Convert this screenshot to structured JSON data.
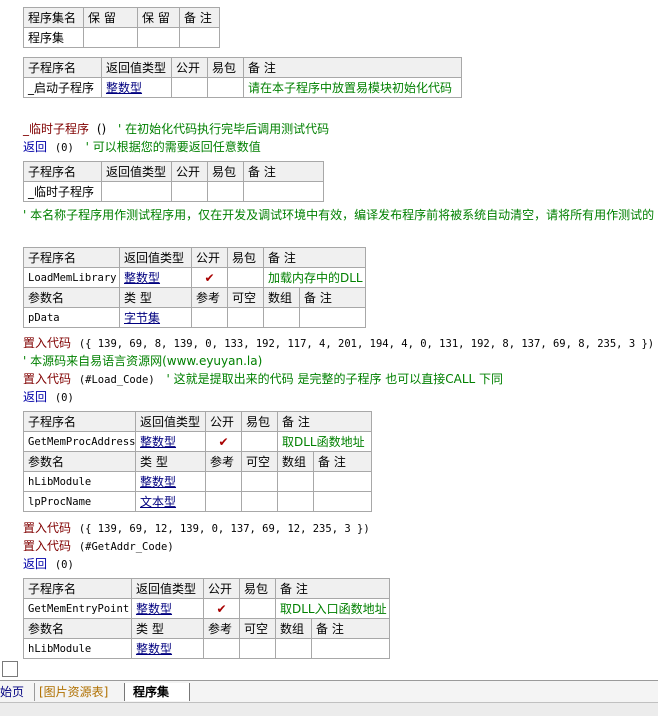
{
  "assembly_table": {
    "headers": [
      "程序集名",
      "保 留",
      "保 留",
      "备 注"
    ],
    "row": [
      "程序集",
      "",
      "",
      ""
    ]
  },
  "sub_start": {
    "headers": [
      "子程序名",
      "返回值类型",
      "公开",
      "易包",
      "备 注"
    ],
    "row": [
      "_启动子程序",
      "整数型",
      "",
      "",
      "请在本子程序中放置易模块初始化代码"
    ]
  },
  "temp_code": {
    "line1_name": "_临时子程序",
    "line1_paren": "()",
    "line1_comment": "' 在初始化代码执行完毕后调用测试代码",
    "line2_kw": "返回",
    "line2_arg": "(0)",
    "line2_comment": "' 可以根据您的需要返回任意数值"
  },
  "sub_temp": {
    "headers": [
      "子程序名",
      "返回值类型",
      "公开",
      "易包",
      "备 注"
    ],
    "row": [
      "_临时子程序",
      "",
      "",
      "",
      ""
    ]
  },
  "temp_note": "' 本名称子程序用作测试程序用，仅在开发及调试环境中有效，编译发布程序前将被系统自动清空，请将所有用作测试的",
  "sub_load": {
    "headers": [
      "子程序名",
      "返回值类型",
      "公开",
      "易包",
      "备 注"
    ],
    "row": [
      "LoadMemLibrary",
      "整数型",
      "✔",
      "",
      "加载内存中的DLL"
    ],
    "param_headers": [
      "参数名",
      "类 型",
      "参考",
      "可空",
      "数组",
      "备 注"
    ],
    "params": [
      [
        "pData",
        "字节集",
        "",
        "",
        "",
        ""
      ]
    ]
  },
  "load_code": {
    "l1_kw": "置入代码",
    "l1_arg": "({ 139, 69, 8, 139, 0, 133, 192, 117, 4, 201, 194, 4, 0, 131, 192, 8, 137, 69, 8, 235, 3 })",
    "l2": "' 本源码来自易语言资源网(www.eyuyan.la)",
    "l3_kw": "置入代码",
    "l3_arg": "(#Load_Code)",
    "l3_comment": "' 这就是提取出来的代码 是完整的子程序 也可以直接CALL 下同",
    "l4_kw": "返回",
    "l4_arg": "(0)"
  },
  "sub_proc": {
    "headers": [
      "子程序名",
      "返回值类型",
      "公开",
      "易包",
      "备 注"
    ],
    "row": [
      "GetMemProcAddress",
      "整数型",
      "✔",
      "",
      "取DLL函数地址"
    ],
    "param_headers": [
      "参数名",
      "类 型",
      "参考",
      "可空",
      "数组",
      "备 注"
    ],
    "params": [
      [
        "hLibModule",
        "整数型",
        "",
        "",
        "",
        ""
      ],
      [
        "lpProcName",
        "文本型",
        "",
        "",
        "",
        ""
      ]
    ]
  },
  "proc_code": {
    "l1_kw": "置入代码",
    "l1_arg": "({ 139, 69, 12, 139, 0, 137, 69, 12, 235, 3 })",
    "l2_kw": "置入代码",
    "l2_arg": "(#GetAddr_Code)",
    "l3_kw": "返回",
    "l3_arg": "(0)"
  },
  "sub_entry": {
    "headers": [
      "子程序名",
      "返回值类型",
      "公开",
      "易包",
      "备 注"
    ],
    "row": [
      "GetMemEntryPoint",
      "整数型",
      "✔",
      "",
      "取DLL入口函数地址"
    ],
    "param_headers": [
      "参数名",
      "类 型",
      "参考",
      "可空",
      "数组",
      "备 注"
    ],
    "params": [
      [
        "hLibModule",
        "整数型",
        "",
        "",
        "",
        ""
      ]
    ]
  },
  "tabs": [
    "始页",
    "[图片资源表]",
    "程序集"
  ]
}
